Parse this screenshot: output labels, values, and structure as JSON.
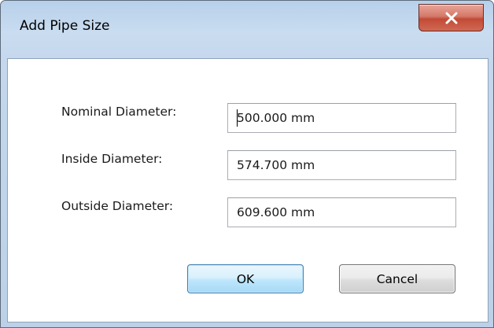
{
  "window": {
    "title": "Add Pipe Size",
    "close_glyph": "X"
  },
  "fields": [
    {
      "label": "Nominal Diameter:",
      "value": "500.000 mm",
      "focused": true
    },
    {
      "label": "Inside Diameter:",
      "value": "574.700 mm",
      "focused": false
    },
    {
      "label": "Outside Diameter:",
      "value": "609.600 mm",
      "focused": false
    }
  ],
  "buttons": {
    "ok_label": "OK",
    "cancel_label": "Cancel"
  },
  "colors": {
    "frame": "#c4d7ec",
    "close_button": "#c24a35",
    "default_button_border": "#3c7fb1"
  },
  "icons": {
    "close": "close-icon"
  }
}
